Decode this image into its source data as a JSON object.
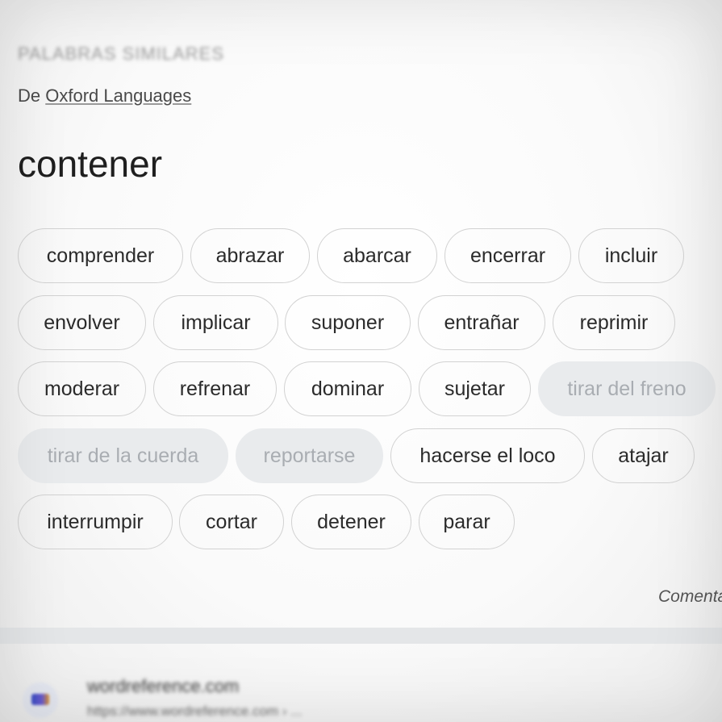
{
  "section": {
    "title": "PALABRAS SIMILARES",
    "source_prefix": "De",
    "source_link": "Oxford Languages"
  },
  "headword": "contener",
  "synonyms": [
    {
      "label": "comprender",
      "enabled": true
    },
    {
      "label": "abrazar",
      "enabled": true
    },
    {
      "label": "abarcar",
      "enabled": true
    },
    {
      "label": "encerrar",
      "enabled": true
    },
    {
      "label": "incluir",
      "enabled": true
    },
    {
      "label": "envolver",
      "enabled": true
    },
    {
      "label": "implicar",
      "enabled": true
    },
    {
      "label": "suponer",
      "enabled": true
    },
    {
      "label": "entrañar",
      "enabled": true
    },
    {
      "label": "reprimir",
      "enabled": true
    },
    {
      "label": "moderar",
      "enabled": true
    },
    {
      "label": "refrenar",
      "enabled": true
    },
    {
      "label": "dominar",
      "enabled": true
    },
    {
      "label": "sujetar",
      "enabled": true
    },
    {
      "label": "tirar del freno",
      "enabled": false
    },
    {
      "label": "tirar de la cuerda",
      "enabled": false
    },
    {
      "label": "reportarse",
      "enabled": false
    },
    {
      "label": "hacerse el loco",
      "enabled": true
    },
    {
      "label": "atajar",
      "enabled": true
    },
    {
      "label": "interrumpir",
      "enabled": true
    },
    {
      "label": "cortar",
      "enabled": true
    },
    {
      "label": "detener",
      "enabled": true
    },
    {
      "label": "parar",
      "enabled": true
    }
  ],
  "feedback_label": "Comentarios",
  "result": {
    "site": "wordreference.com",
    "url": "https://www.wordreference.com › ..."
  },
  "colors": {
    "chip_border": "#d2d2d2",
    "chip_disabled_bg": "#e9ebed",
    "chip_disabled_text": "#a9adb2",
    "text_primary": "#2b2b2b"
  }
}
